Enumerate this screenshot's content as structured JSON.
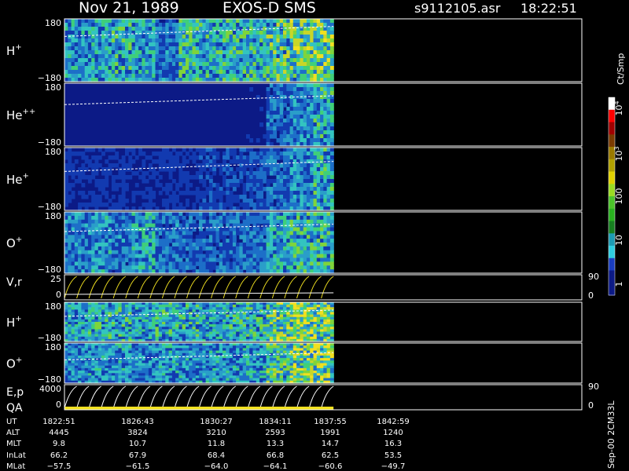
{
  "header": {
    "date": "Nov 21, 1989",
    "instrument": "EXOS-D SMS",
    "file": "s9112105.asr",
    "time": "18:22:51"
  },
  "chart_data": [
    {
      "type": "heatmap",
      "species": "H",
      "charge": "+",
      "ytop": "180",
      "ybottom": "−180",
      "intensity": [
        0.45,
        0.5,
        0.6,
        0.5,
        0.35,
        0.6,
        0.55,
        0.6,
        0.6,
        0.65,
        0.7,
        0.75
      ],
      "pitch_line": [
        0.28,
        0.12
      ],
      "fill": 0.52
    },
    {
      "type": "heatmap",
      "species": "He",
      "charge": "++",
      "ytop": "180",
      "ybottom": "−180",
      "intensity": [
        0.05,
        0.05,
        0.05,
        0.05,
        0.05,
        0.05,
        0.05,
        0.05,
        0.1,
        0.3,
        0.4,
        0.55
      ],
      "pitch_line": [
        0.34,
        0.2
      ],
      "fill": 0.52
    },
    {
      "type": "heatmap",
      "species": "He",
      "charge": "+",
      "ytop": "180",
      "ybottom": "−180",
      "intensity": [
        0.15,
        0.15,
        0.15,
        0.15,
        0.15,
        0.15,
        0.2,
        0.2,
        0.25,
        0.3,
        0.4,
        0.55
      ],
      "pitch_line": [
        0.38,
        0.22
      ],
      "fill": 0.52
    },
    {
      "type": "heatmap",
      "species": "O",
      "charge": "+",
      "ytop": "180",
      "ybottom": "−180",
      "intensity": [
        0.4,
        0.45,
        0.35,
        0.5,
        0.35,
        0.3,
        0.3,
        0.3,
        0.35,
        0.5,
        0.6,
        0.6
      ],
      "pitch_line": [
        0.32,
        0.2
      ],
      "fill": 0.52
    },
    {
      "type": "line",
      "label": "V,r",
      "ytop": "25",
      "ybottom": "0",
      "right_top": "90",
      "right_bottom": "0"
    },
    {
      "type": "heatmap",
      "species": "H",
      "charge": "+",
      "ytop": "180",
      "ybottom": "−180",
      "intensity": [
        0.5,
        0.55,
        0.55,
        0.5,
        0.55,
        0.55,
        0.5,
        0.55,
        0.6,
        0.75,
        0.85,
        0.8
      ],
      "pitch_line": [
        0.36,
        0.2
      ],
      "fill": 0.52
    },
    {
      "type": "heatmap",
      "species": "O",
      "charge": "+",
      "ytop": "180",
      "ybottom": "−180",
      "intensity": [
        0.4,
        0.45,
        0.45,
        0.4,
        0.45,
        0.45,
        0.45,
        0.45,
        0.5,
        0.65,
        0.8,
        0.85
      ],
      "pitch_line": [
        0.42,
        0.24
      ],
      "fill": 0.52
    },
    {
      "type": "line",
      "label": "E,p",
      "label2": "QA",
      "ytop": "4000",
      "ybottom": "0",
      "right_top": "90",
      "right_bottom": "0"
    }
  ],
  "colorbar": {
    "unit": "Ct/Smp",
    "ticks": [
      {
        "label": "10",
        "sup": "4"
      },
      {
        "label": "10",
        "sup": "3"
      },
      {
        "label": "100",
        "sup": ""
      },
      {
        "label": "10",
        "sup": ""
      },
      {
        "label": "1",
        "sup": ""
      }
    ]
  },
  "footer": {
    "row_labels": [
      "UT",
      "ALT",
      "MLT",
      "InLat",
      "MLat"
    ],
    "columns": [
      [
        "1822:51",
        "4445",
        "9.8",
        "66.2",
        "−57.5"
      ],
      [
        "1826:43",
        "3824",
        "10.7",
        "67.9",
        "−61.5"
      ],
      [
        "1830:27",
        "3210",
        "11.8",
        "68.4",
        "−64.0"
      ],
      [
        "1834:11",
        "2593",
        "13.3",
        "66.8",
        "−64.1"
      ],
      [
        "1837:55",
        "1991",
        "14.7",
        "62.5",
        "−60.6"
      ],
      [
        "1842:59",
        "1240",
        "16.3",
        "53.5",
        "−49.7"
      ]
    ],
    "side_note": "Sep-00 2CM33L"
  }
}
